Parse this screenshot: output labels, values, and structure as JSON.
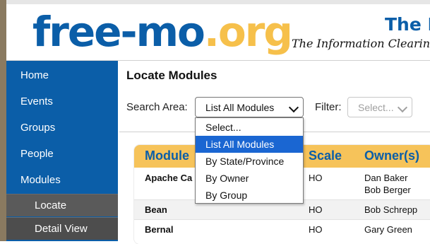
{
  "header": {
    "logo_main": "free-mo",
    "logo_tld": ".org",
    "site_title": "The I",
    "tagline": "The Information Clearing"
  },
  "sidebar": {
    "items": [
      {
        "label": "Home"
      },
      {
        "label": "Events"
      },
      {
        "label": "Groups"
      },
      {
        "label": "People"
      },
      {
        "label": "Modules"
      }
    ],
    "subitems": [
      {
        "label": "Locate",
        "active": true
      },
      {
        "label": "Detail View"
      }
    ]
  },
  "main": {
    "title": "Locate Modules",
    "search_area_label": "Search Area:",
    "search_area_value": "List All Modules",
    "filter_label": "Filter:",
    "filter_value": "Select..."
  },
  "dropdown": {
    "options": [
      "Select...",
      "List All Modules",
      "By State/Province",
      "By Owner",
      "By Group"
    ],
    "selected_index": 1
  },
  "table": {
    "headers": [
      "Module",
      "Scale",
      "Owner(s)"
    ],
    "rows": [
      {
        "module": "Apache Ca",
        "scale": "HO",
        "owners": [
          "Dan Baker",
          "Bob Berger"
        ]
      },
      {
        "module": "Bean",
        "scale": "HO",
        "owners": [
          "Bob Schrepp"
        ]
      },
      {
        "module": "Bernal",
        "scale": "HO",
        "owners": [
          "Gary Green"
        ]
      }
    ]
  },
  "colors": {
    "brand_blue": "#0b5ea8",
    "brand_gold": "#f6c04b",
    "header_row": "#f6c35a",
    "selection": "#1a66d2"
  }
}
